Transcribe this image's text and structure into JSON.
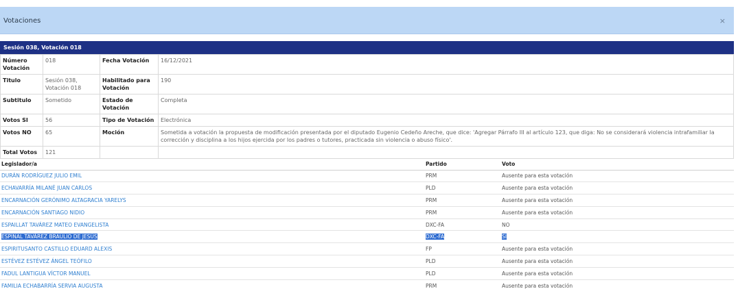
{
  "modal": {
    "title": "Votaciones",
    "close_symbol": "×"
  },
  "section_header": "Sesión 038, Votación 018",
  "info": {
    "numero_label": "Número Votación",
    "numero_value": "018",
    "fecha_label": "Fecha Votación",
    "fecha_value": "16/12/2021",
    "titulo_label": "Titulo",
    "titulo_value": "Sesión 038, Votación 018",
    "habilitado_label": "Habilitado para Votación",
    "habilitado_value": "190",
    "subtitulo_label": "Subtitulo",
    "subtitulo_value": "Sometido",
    "estado_label": "Estado de Votación",
    "estado_value": "Completa",
    "votos_si_label": "Votos SI",
    "votos_si_value": "56",
    "tipo_label": "Tipo de Votación",
    "tipo_value": "Electrónica",
    "votos_no_label": "Votos NO",
    "votos_no_value": "65",
    "mocion_label": "Moción",
    "mocion_value": "Sometida a votación la propuesta de modificación presentada por el diputado Eugenio Cedeño Areche, que dice: 'Agregar Párrafo III al artículo 123, que diga: No se considerará violencia intrafamiliar la corrección y disciplina a los hijos ejercida por los padres o tutores, practicada sin violencia o abuso físico'.",
    "total_label": "Total Votos",
    "total_value": "121"
  },
  "votes": {
    "headers": {
      "legislador": "Legislador/a",
      "partido": "Partido",
      "voto": "Voto"
    },
    "rows": [
      {
        "name": "DURÁN RODRÍGUEZ JULIO EMIL",
        "party": "PRM",
        "vote": "Ausente para esta votación"
      },
      {
        "name": "ECHAVARRÍA MILANÉ JUAN CARLOS",
        "party": "PLD",
        "vote": "Ausente para esta votación"
      },
      {
        "name": "ENCARNACIÓN GERÓNIMO ALTAGRACIA YARELYS",
        "party": "PRM",
        "vote": "Ausente para esta votación"
      },
      {
        "name": "ENCARNACIÓN SANTIAGO NIDIO",
        "party": "PRM",
        "vote": "Ausente para esta votación"
      },
      {
        "name": "ESPAILLAT TAVÁREZ MATEO EVANGELISTA",
        "party": "DXC-FA",
        "vote": "NO"
      },
      {
        "name": "ESPINAL TAVÁREZ BRAULIO DE JESÚS",
        "party": "DXC-FA",
        "vote": "SI"
      },
      {
        "name": "ESPIRITUSANTO CASTILLO EDUARD ALEXIS",
        "party": "FP",
        "vote": "Ausente para esta votación"
      },
      {
        "name": "ESTÉVEZ ESTÉVEZ ÁNGEL TEÓFILO",
        "party": "PLD",
        "vote": "Ausente para esta votación"
      },
      {
        "name": "FADUL LANTIGUA VÍCTOR MANUEL",
        "party": "PLD",
        "vote": "Ausente para esta votación"
      },
      {
        "name": "FAMILIA ECHABARRÍA SERVIA AUGUSTA",
        "party": "PRM",
        "vote": "Ausente para esta votación"
      }
    ]
  }
}
